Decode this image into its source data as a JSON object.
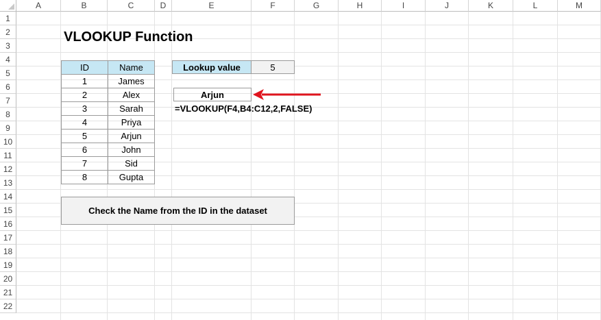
{
  "columns": [
    "A",
    "B",
    "C",
    "D",
    "E",
    "F",
    "G",
    "H",
    "I",
    "J",
    "K",
    "L",
    "M"
  ],
  "rows": [
    "1",
    "2",
    "3",
    "4",
    "5",
    "6",
    "7",
    "8",
    "9",
    "10",
    "11",
    "12",
    "13",
    "14",
    "15",
    "16",
    "17",
    "18",
    "19",
    "20",
    "21",
    "22"
  ],
  "title": "VLOOKUP Function",
  "table": {
    "headers": [
      "ID",
      "Name"
    ],
    "rows": [
      [
        "1",
        "James"
      ],
      [
        "2",
        "Alex"
      ],
      [
        "3",
        "Sarah"
      ],
      [
        "4",
        "Priya"
      ],
      [
        "5",
        "Arjun"
      ],
      [
        "6",
        "John"
      ],
      [
        "7",
        "Sid"
      ],
      [
        "8",
        "Gupta"
      ]
    ]
  },
  "lookup": {
    "label": "Lookup value",
    "value": "5"
  },
  "result": {
    "value": "Arjun"
  },
  "formula": "=VLOOKUP(F4,B4:C12,2,FALSE)",
  "note": "Check the Name from the ID in the dataset",
  "colors": {
    "header_fill": "#c6e7f4",
    "arrow": "#e0141e",
    "note_fill": "#f2f2f2"
  },
  "icons": {
    "arrow": "arrow-left-icon"
  }
}
